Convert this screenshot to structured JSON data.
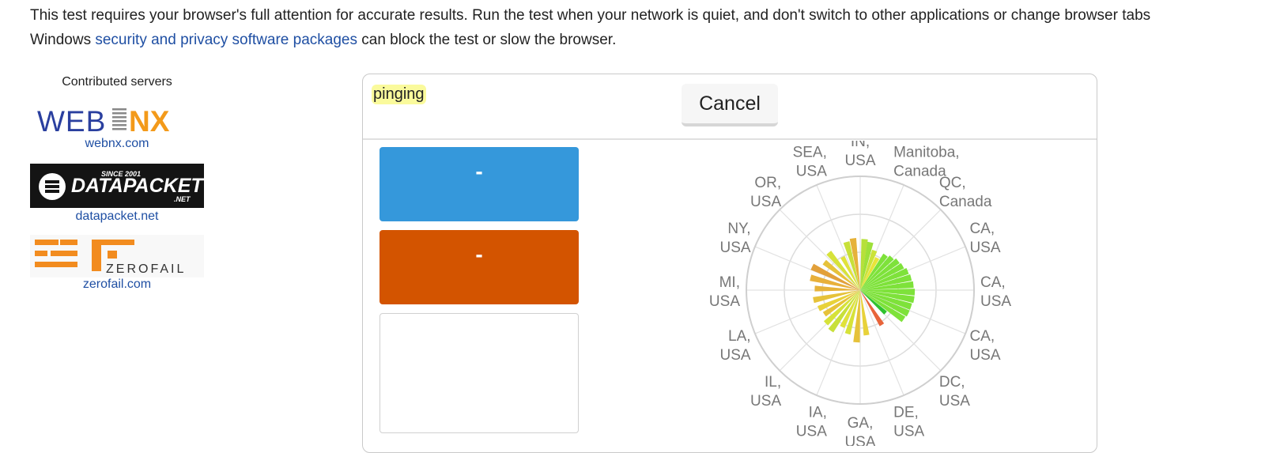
{
  "intro": {
    "line1": "This test requires your browser's full attention for accurate results. Run the test when your network is quiet, and don't switch to other applications or change browser tabs",
    "line2_prefix": "Windows ",
    "line2_link": "security and privacy software packages",
    "line2_suffix": " can block the test or slow the browser."
  },
  "sidebar": {
    "title": "Contributed servers",
    "sponsors": [
      {
        "logo_text": "WEBNX",
        "link": "webnx.com"
      },
      {
        "logo_text": "DATAPACKET",
        "logo_small_top": "SINCE 2001",
        "logo_small_bottom": ".NET",
        "link": "datapacket.net"
      },
      {
        "logo_text": "ZEROFAIL",
        "link": "zerofail.com"
      }
    ]
  },
  "panel": {
    "status": "pinging",
    "cancel_label": "Cancel",
    "metrics": [
      {
        "label": "-",
        "color": "#3598db"
      },
      {
        "label": "-",
        "color": "#d35400"
      },
      {
        "label": "",
        "color": "#ffffff"
      }
    ]
  },
  "chart_data": {
    "type": "polar-bar",
    "servers": [
      [
        "IN,",
        "USA"
      ],
      [
        "Manitoba,",
        "Canada"
      ],
      [
        "QC,",
        "Canada"
      ],
      [
        "CA,",
        "USA"
      ],
      [
        "CA,",
        "USA"
      ],
      [
        "CA,",
        "USA"
      ],
      [
        "DC,",
        "USA"
      ],
      [
        "DE,",
        "USA"
      ],
      [
        "GA,",
        "USA"
      ],
      [
        "IA,",
        "USA"
      ],
      [
        "IL,",
        "USA"
      ],
      [
        "LA,",
        "USA"
      ],
      [
        "MI,",
        "USA"
      ],
      [
        "NY,",
        "USA"
      ],
      [
        "OR,",
        "USA"
      ],
      [
        "SEA,",
        "USA"
      ]
    ],
    "bars": [
      {
        "angle": 5,
        "value": 0.45,
        "color": "#b6e03a"
      },
      {
        "angle": 12,
        "value": 0.43,
        "color": "#9ee03a"
      },
      {
        "angle": 20,
        "value": 0.37,
        "color": "#cbe33a"
      },
      {
        "angle": 28,
        "value": 0.32,
        "color": "#e9e43a"
      },
      {
        "angle": 36,
        "value": 0.38,
        "color": "#7ee23a"
      },
      {
        "angle": 44,
        "value": 0.4,
        "color": "#7ee23a"
      },
      {
        "angle": 52,
        "value": 0.42,
        "color": "#7ee23a"
      },
      {
        "angle": 60,
        "value": 0.43,
        "color": "#7ee23a"
      },
      {
        "angle": 68,
        "value": 0.45,
        "color": "#7ee23a"
      },
      {
        "angle": 76,
        "value": 0.46,
        "color": "#7ee23a"
      },
      {
        "angle": 84,
        "value": 0.47,
        "color": "#7ee23a"
      },
      {
        "angle": 92,
        "value": 0.48,
        "color": "#7ee23a"
      },
      {
        "angle": 100,
        "value": 0.48,
        "color": "#7ee23a"
      },
      {
        "angle": 108,
        "value": 0.47,
        "color": "#7ee23a"
      },
      {
        "angle": 116,
        "value": 0.47,
        "color": "#7ee23a"
      },
      {
        "angle": 124,
        "value": 0.46,
        "color": "#7ee23a"
      },
      {
        "angle": 132,
        "value": 0.3,
        "color": "#2ec22e"
      },
      {
        "angle": 148,
        "value": 0.36,
        "color": "#e8643a"
      },
      {
        "angle": 172,
        "value": 0.4,
        "color": "#e8d23a"
      },
      {
        "angle": 184,
        "value": 0.46,
        "color": "#e6c23a"
      },
      {
        "angle": 196,
        "value": 0.4,
        "color": "#d6e23a"
      },
      {
        "angle": 206,
        "value": 0.36,
        "color": "#e0e23a"
      },
      {
        "angle": 216,
        "value": 0.44,
        "color": "#c8e03a"
      },
      {
        "angle": 226,
        "value": 0.42,
        "color": "#d6e23a"
      },
      {
        "angle": 236,
        "value": 0.38,
        "color": "#e6c23a"
      },
      {
        "angle": 246,
        "value": 0.4,
        "color": "#e8d23a"
      },
      {
        "angle": 258,
        "value": 0.42,
        "color": "#e6c23a"
      },
      {
        "angle": 272,
        "value": 0.4,
        "color": "#e6b23a"
      },
      {
        "angle": 284,
        "value": 0.45,
        "color": "#e8b03a"
      },
      {
        "angle": 296,
        "value": 0.47,
        "color": "#e2a03a"
      },
      {
        "angle": 308,
        "value": 0.4,
        "color": "#e6c23a"
      },
      {
        "angle": 320,
        "value": 0.43,
        "color": "#d6e23a"
      },
      {
        "angle": 332,
        "value": 0.33,
        "color": "#e0e23a"
      },
      {
        "angle": 344,
        "value": 0.44,
        "color": "#c8e03a"
      },
      {
        "angle": 352,
        "value": 0.46,
        "color": "#e6b23a"
      }
    ],
    "grid": true,
    "rings": 3
  }
}
